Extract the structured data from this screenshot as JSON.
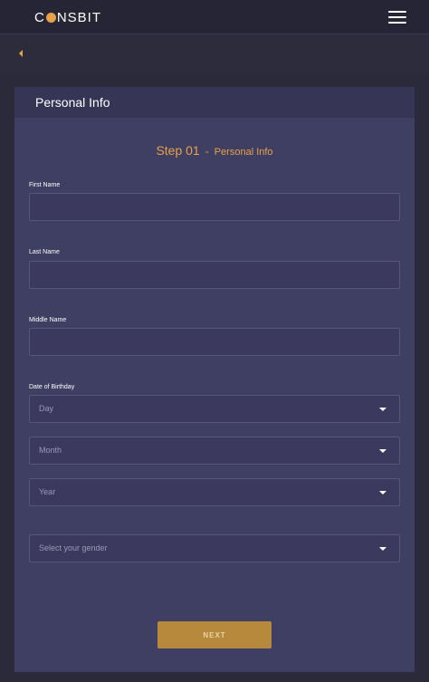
{
  "header": {
    "logo_prefix": "C",
    "logo_suffix": "NSBIT",
    "menu_icon": "hamburger-menu-icon",
    "back_icon": "back-arrow-icon"
  },
  "card": {
    "title": "Personal Info",
    "step_number": "Step 01",
    "step_separator": "-",
    "step_label": "Personal Info"
  },
  "form": {
    "first_name_label": "First Name",
    "first_name_value": "",
    "last_name_label": "Last Name",
    "last_name_value": "",
    "middle_name_label": "Middle Name",
    "middle_name_value": "",
    "dob_label": "Date of Birthday",
    "day_placeholder": "Day",
    "month_placeholder": "Month",
    "year_placeholder": "Year",
    "gender_placeholder": "Select your gender",
    "next_label": "NEXT"
  },
  "colors": {
    "accent": "#e8a24a",
    "card_bg": "#3f3e63",
    "page_bg": "#2a2a3a",
    "button_bg": "#b7893d"
  }
}
